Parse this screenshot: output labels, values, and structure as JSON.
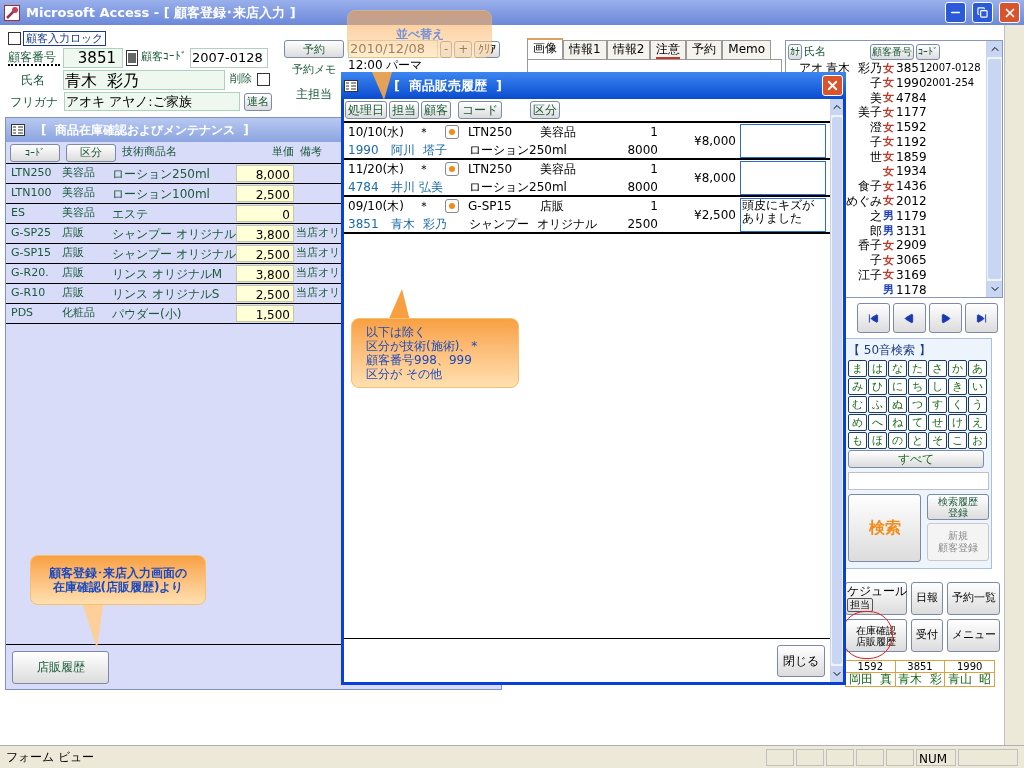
{
  "window": {
    "title": "Microsoft Access - [ 顧客登録･来店入力 ]"
  },
  "customer_form": {
    "lock": {
      "label": "顧客入力ロック",
      "checked": false
    },
    "customer_number": {
      "label": "顧客番号",
      "value": "3851"
    },
    "customer_code": {
      "label": "顧客ｺｰﾄﾞ",
      "value": "2007-0128"
    },
    "reserve_button": "予約",
    "reserve_date": "2010/12/08",
    "date_buttons": [
      "-",
      "+",
      "ｸﾘｱ"
    ],
    "reserve_memo": {
      "label": "予約メモ",
      "value": "12:00 パーマ"
    },
    "name": {
      "label": "氏名",
      "value": "青木  彩乃"
    },
    "delete": {
      "label": "削除",
      "checked": false
    },
    "furigana": {
      "label": "フリガナ",
      "value": "アオキ アヤノ:ご家族"
    },
    "joint_name_button": "連名",
    "main_staff_label": "主担当"
  },
  "tabs": [
    {
      "label": "画像",
      "selected": true,
      "flagged": false
    },
    {
      "label": "情報1",
      "selected": false,
      "flagged": false
    },
    {
      "label": "情報2",
      "selected": false,
      "flagged": false
    },
    {
      "label": "注意",
      "selected": false,
      "flagged": true
    },
    {
      "label": "予約",
      "selected": false,
      "flagged": false
    },
    {
      "label": "Memo",
      "selected": false,
      "flagged": false
    }
  ],
  "customer_list": {
    "kana_button": "ｶﾅ",
    "name_label": "氏名",
    "number_button": "顧客番号",
    "code_button": "ｺｰﾄﾞ",
    "rows": [
      {
        "name": "アオ 青木  彩乃",
        "gender": "女",
        "color": "#c0392b",
        "number": "3851",
        "code": "2007-0128"
      },
      {
        "name": "子",
        "gender": "女",
        "color": "#c0392b",
        "number": "1990",
        "code": "2001-254"
      },
      {
        "name": "美",
        "gender": "女",
        "color": "#c0392b",
        "number": "4784"
      },
      {
        "name": "美子",
        "gender": "女",
        "color": "#c0392b",
        "number": "1177"
      },
      {
        "name": "澄",
        "gender": "女",
        "color": "#c0392b",
        "number": "1592"
      },
      {
        "name": "子",
        "gender": "女",
        "color": "#c0392b",
        "number": "1192"
      },
      {
        "name": "世",
        "gender": "女",
        "color": "#c0392b",
        "number": "1859"
      },
      {
        "gender": "女",
        "color": "#c0392b",
        "number": "1934"
      },
      {
        "name": "食子",
        "gender": "女",
        "color": "#c0392b",
        "number": "1436"
      },
      {
        "name": "めぐみ",
        "gender": "女",
        "color": "#c0392b",
        "number": "2012"
      },
      {
        "name": "之",
        "gender": "男",
        "color": "#1f3fbf",
        "number": "1179"
      },
      {
        "name": "郎",
        "gender": "男",
        "color": "#1f3fbf",
        "number": "3131"
      },
      {
        "name": "香子",
        "gender": "女",
        "color": "#c0392b",
        "number": "2909"
      },
      {
        "name": "子",
        "gender": "女",
        "color": "#c0392b",
        "number": "3065"
      },
      {
        "name": "江子",
        "gender": "女",
        "color": "#c0392b",
        "number": "3169"
      },
      {
        "gender": "男",
        "color": "#1f3fbf",
        "number": "1178"
      }
    ]
  },
  "kana_search": {
    "title": "【 50音検索 】",
    "rows": [
      [
        "ま",
        "は",
        "な",
        "た",
        "さ",
        "か",
        "あ"
      ],
      [
        "み",
        "ひ",
        "に",
        "ち",
        "し",
        "き",
        "い"
      ],
      [
        "む",
        "ふ",
        "ぬ",
        "つ",
        "す",
        "く",
        "う"
      ],
      [
        "め",
        "へ",
        "ね",
        "て",
        "せ",
        "け",
        "え"
      ],
      [
        "も",
        "ほ",
        "の",
        "と",
        "そ",
        "こ",
        "お"
      ]
    ],
    "all_button": "すべて"
  },
  "search_button": "検索",
  "history_button": [
    "検索履歴",
    "登録"
  ],
  "new_customer_button": {
    "lines": [
      "新規",
      "顧客登録"
    ],
    "disabled": true
  },
  "schedule_button": {
    "label": "ケジュール",
    "sub": "担当"
  },
  "action_buttons": [
    {
      "lines": [
        "日報"
      ],
      "highlighted": false
    },
    {
      "lines": [
        "予約一覧"
      ],
      "highlighted": false
    },
    {
      "lines": [
        "在庫確認",
        "店販履歴"
      ],
      "highlighted": true
    },
    {
      "lines": [
        "受付"
      ],
      "highlighted": false
    },
    {
      "lines": [
        "メニュー"
      ],
      "highlighted": false
    }
  ],
  "recent_customers": [
    {
      "number": "1592",
      "name": "岡田  真"
    },
    {
      "number": "3851",
      "name": "青木  彩"
    },
    {
      "number": "1990",
      "name": "青山  昭"
    }
  ],
  "inventory_window": {
    "title": "[  商品在庫確認およびメンテナンス  ]",
    "sort_buttons": [
      "ｺｰﾄﾞ",
      "区分"
    ],
    "columns": [
      "技術商品名",
      "単価",
      "備考"
    ],
    "rows": [
      {
        "code": "LTN250",
        "category": "美容品",
        "name": "ローション250ml",
        "price": "8,000"
      },
      {
        "code": "LTN100",
        "category": "美容品",
        "name": "ローション100ml",
        "price": "2,500"
      },
      {
        "code": "ES",
        "category": "美容品",
        "name": "エステ",
        "price": "0"
      },
      {
        "code": "G-SP25",
        "category": "店販",
        "name": "シャンプー オリジナル",
        "price": "3,800",
        "remark": "当店オリ"
      },
      {
        "code": "G-SP15",
        "category": "店販",
        "name": "シャンプー オリジナル",
        "price": "2,500",
        "remark": "当店オリ"
      },
      {
        "code": "G-R20.",
        "category": "店販",
        "name": "リンス オリジナルM",
        "price": "3,800",
        "remark": "当店オリ"
      },
      {
        "code": "G-R10",
        "category": "店販",
        "name": "リンス オリジナルS",
        "price": "2,500",
        "remark": "当店オリ"
      },
      {
        "code": "PDS",
        "category": "化粧品",
        "name": "パウダー(小)",
        "price": "1,500"
      }
    ],
    "bottom_button": "店販履歴"
  },
  "sales_history_window": {
    "title": "[  商品販売履歴  ]",
    "sort_buttons": [
      "処理日",
      "担当",
      "顧客",
      "コード",
      "区分"
    ],
    "rows": [
      {
        "date": "10/10(水)",
        "mark": "＊",
        "code": "LTN250",
        "category": "美容品",
        "qty": "1",
        "customer_number": "1990",
        "customer_name": "阿川  塔子",
        "product": "ローション250ml",
        "unit_price": "8000",
        "amount": "¥8,000"
      },
      {
        "date": "11/20(木)",
        "mark": "＊",
        "code": "LTN250",
        "category": "美容品",
        "qty": "1",
        "customer_number": "4784",
        "customer_name": "井川 弘美",
        "product": "ローション250ml",
        "unit_price": "8000",
        "amount": "¥8,000"
      },
      {
        "date": "09/10(木)",
        "mark": "＊",
        "code": "G-SP15",
        "category": "店販",
        "qty": "1",
        "customer_number": "3851",
        "customer_name": "青木  彩乃",
        "product": "シャンプー  オリジナル",
        "unit_price": "2500",
        "amount": "¥2,500",
        "note": "頭皮にキズがありました"
      }
    ],
    "close_button": "閉じる"
  },
  "callouts": [
    {
      "lines": [
        "並べ替え"
      ]
    },
    {
      "lines": [
        "以下は除く",
        "区分が技術(施術)、*",
        "顧客番号998、999",
        "区分が  その他"
      ]
    },
    {
      "lines": [
        "顧客登録･来店入力画面の",
        "在庫確認(店販履歴)より"
      ]
    }
  ],
  "status_bar": {
    "view": "フォーム ビュー",
    "num": "NUM"
  }
}
